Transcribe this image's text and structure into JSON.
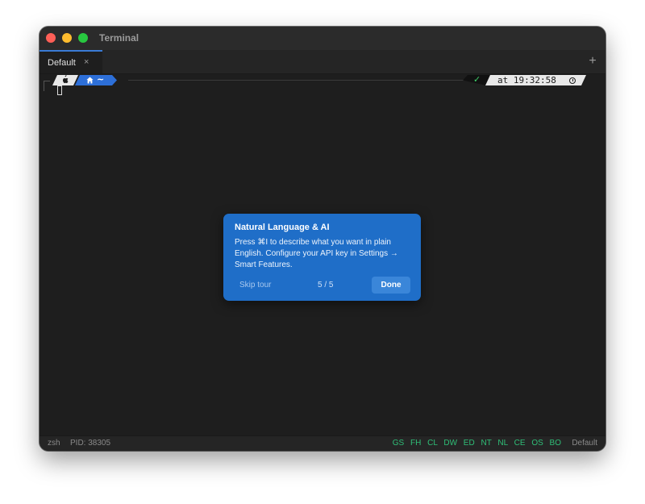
{
  "window": {
    "title": "Terminal"
  },
  "tabs": [
    {
      "label": "Default",
      "close": "×"
    }
  ],
  "new_tab": "+",
  "prompt": {
    "directory": "~",
    "status_symbol": "✓",
    "time_text": "at 19:32:58"
  },
  "tour": {
    "title": "Natural Language & AI",
    "body": "Press ⌘I to describe what you want in plain English. Configure your API key in Settings → Smart Features.",
    "skip": "Skip tour",
    "step": "5 / 5",
    "done": "Done"
  },
  "statusbar": {
    "shell": "zsh",
    "pid": "PID: 38305",
    "flags": [
      "GS",
      "FH",
      "CL",
      "DW",
      "ED",
      "NT",
      "NL",
      "CE",
      "OS",
      "BO"
    ],
    "profile": "Default"
  },
  "colors": {
    "popup": "#1f6ec8",
    "accent": "#2d6fd8",
    "flags": "#2fbf78"
  }
}
